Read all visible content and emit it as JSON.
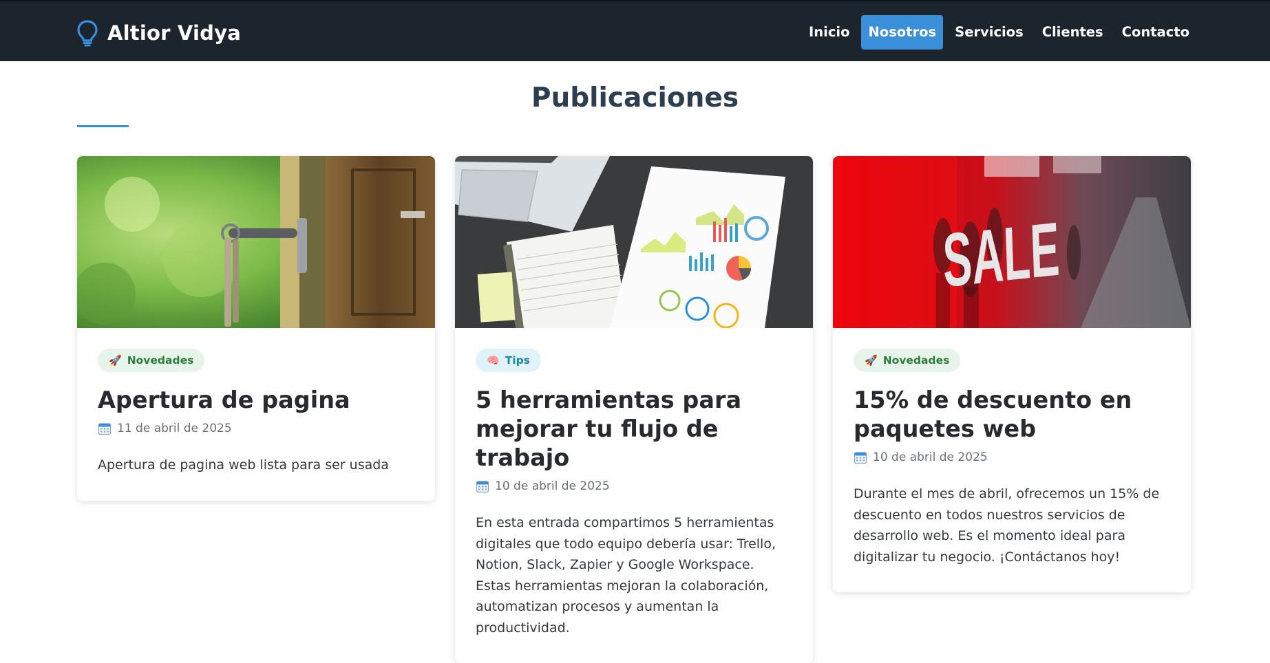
{
  "header": {
    "brand": "Altior Vidya",
    "brand_icon": "lightbulb-icon",
    "nav": [
      {
        "label": "Inicio",
        "active": false
      },
      {
        "label": "Nosotros",
        "active": true
      },
      {
        "label": "Servicios",
        "active": false
      },
      {
        "label": "Clientes",
        "active": false
      },
      {
        "label": "Contacto",
        "active": false
      }
    ]
  },
  "colors": {
    "navbar_bg": "#1c242e",
    "accent": "#3a8fd9",
    "title": "#2c3e50"
  },
  "main": {
    "title": "Publicaciones",
    "posts": [
      {
        "image": "door-key-photo",
        "tag": "Novedades",
        "tag_icon": "rocket-icon",
        "title": "Apertura de pagina",
        "date": "11 de abril de 2025",
        "excerpt": "Apertura de pagina web lista para ser usada"
      },
      {
        "image": "laptop-charts-photo",
        "tag": "Tips",
        "tag_icon": "brain-icon",
        "title": "5 herramientas para mejorar tu flujo de trabajo",
        "date": "10 de abril de 2025",
        "excerpt": "En esta entrada compartimos 5 herramientas digitales que todo equipo debería usar: Trello, Notion, Slack, Zapier y Google Workspace. Estas herramientas mejoran la colaboración, automatizan procesos y aumentan la productividad."
      },
      {
        "image": "sale-window-photo",
        "image_text": "SALE",
        "tag": "Novedades",
        "tag_icon": "rocket-icon",
        "title": "15% de descuento en paquetes web",
        "date": "10 de abril de 2025",
        "excerpt": "Durante el mes de abril, ofrecemos un 15% de descuento en todos nuestros servicios de desarrollo web. Es el momento ideal para digitalizar tu negocio. ¡Contáctanos hoy!"
      }
    ]
  }
}
